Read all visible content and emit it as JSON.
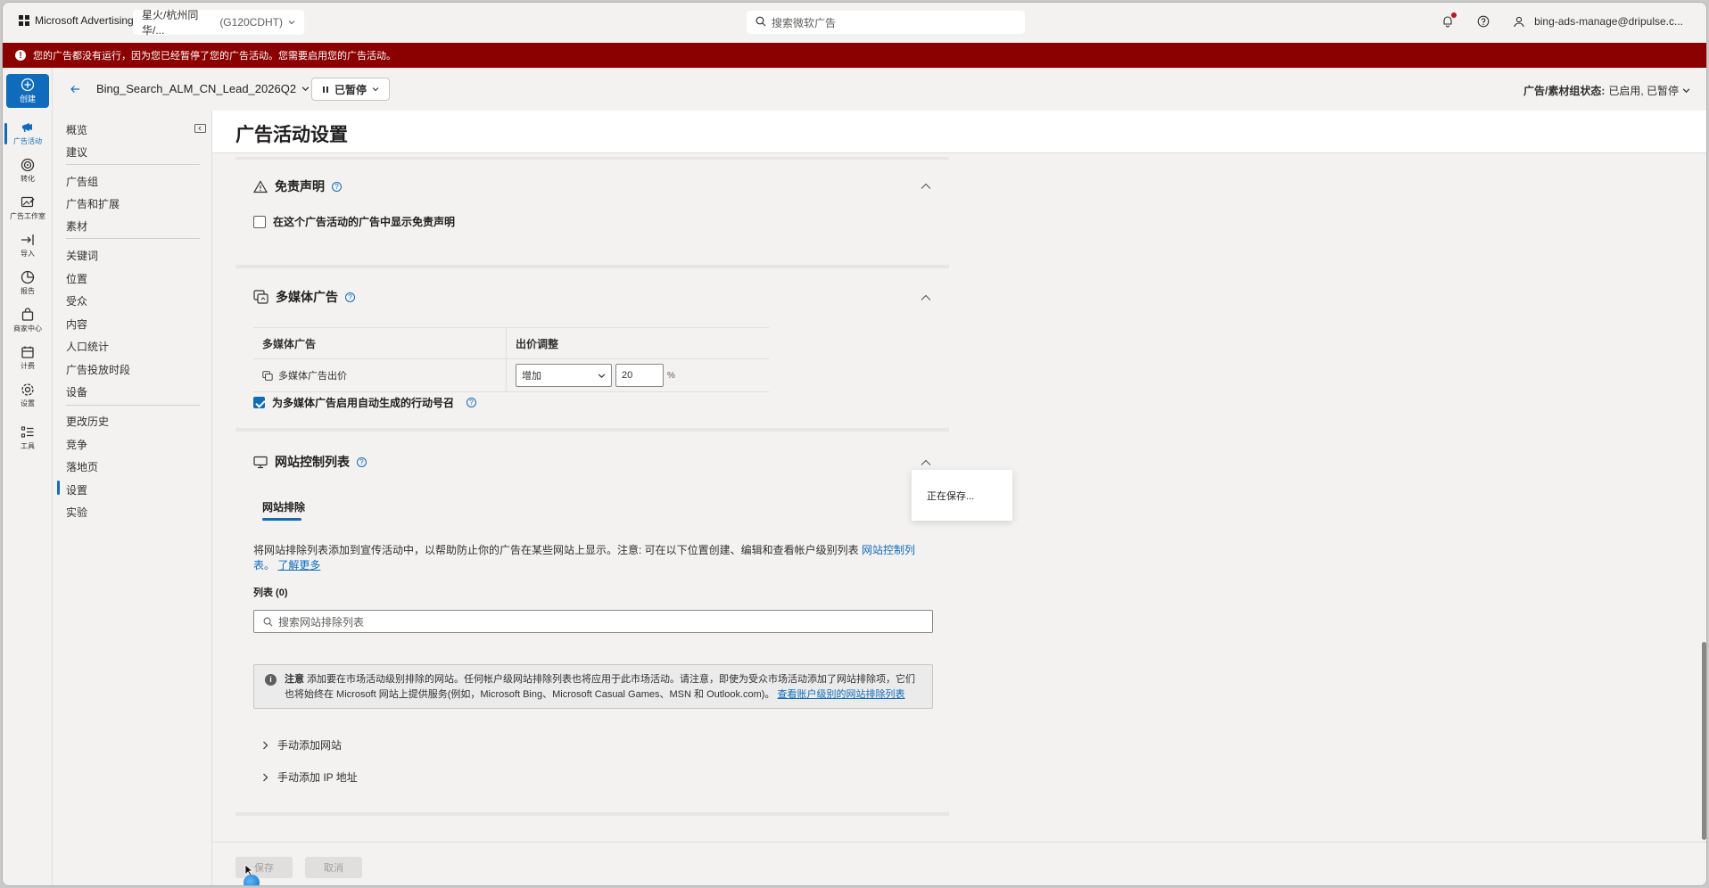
{
  "topbar": {
    "brand": "Microsoft Advertising",
    "account_name": "星火/杭州同华/...",
    "account_id": "(G120CDHT)",
    "search_placeholder": "搜索微软广告",
    "user_email": "bing-ads-manage@dripulse.c..."
  },
  "banner": {
    "message": "您的广告都没有运行，因为您已经暂停了您的广告活动。您需要启用您的广告活动。"
  },
  "rail": {
    "create": "创建",
    "items": [
      "广告活动",
      "转化",
      "广告工作室",
      "导入",
      "报告",
      "商家中心",
      "计费",
      "设置",
      "工具"
    ]
  },
  "campaign": {
    "name": "Bing_Search_ALM_CN_Lead_2026Q2",
    "status": "已暂停",
    "status_label": "广告/素材组状态:",
    "status_value": "已启用, 已暂停"
  },
  "subnav": {
    "items": [
      "概览",
      "建议",
      "广告组",
      "广告和扩展",
      "素材",
      "关键词",
      "位置",
      "受众",
      "内容",
      "人口统计",
      "广告投放时段",
      "设备",
      "更改历史",
      "竞争",
      "落地页",
      "设置",
      "实验"
    ]
  },
  "page": {
    "title": "广告活动设置"
  },
  "disclaimer": {
    "title": "免责声明",
    "checkbox_label": "在这个广告活动的广告中显示免责声明"
  },
  "multimedia": {
    "title": "多媒体广告",
    "col1": "多媒体广告",
    "col2": "出价调整",
    "row_label": "多媒体广告出价",
    "adjust_option": "增加",
    "adjust_value": "20",
    "unit": "%",
    "auto_cta_label": "为多媒体广告启用自动生成的行动号召"
  },
  "site_control": {
    "title": "网站控制列表",
    "tab": "网站排除",
    "desc_text": "将网站排除列表添加到宣传活动中，以帮助防止你的广告在某些网站上显示。注意: 可在以下位置创建、编辑和查看帐户级别列表",
    "desc_link": "网站控制列表。",
    "learn_more": "了解更多",
    "list_count": "列表 (0)",
    "search_placeholder": "搜索网站排除列表",
    "note_title": "注意",
    "note_text": "添加要在市场活动级别排除的网站。任何帐户级网站排除列表也将应用于此市场活动。请注意，即使为受众市场活动添加了网站排除项，它们也将始终在 Microsoft 网站上提供服务(例如，Microsoft Bing、Microsoft Casual Games、MSN 和 Outlook.com)。",
    "note_link": "查看账户级别的网站排除列表",
    "manual_site": "手动添加网站",
    "manual_ip": "手动添加 IP 地址"
  },
  "saving": "正在保存...",
  "footer": {
    "save": "保存",
    "cancel": "取消"
  }
}
